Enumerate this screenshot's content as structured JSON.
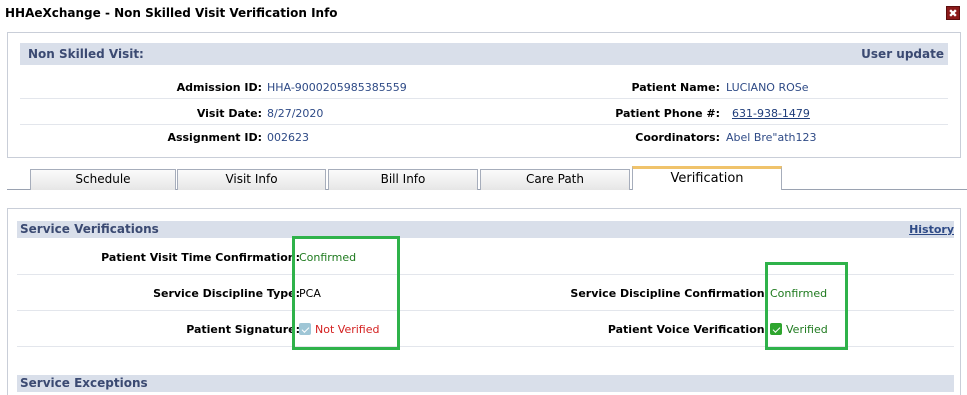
{
  "window": {
    "title": "HHAeXchange - Non Skilled Visit Verification Info",
    "close_glyph": "✖"
  },
  "visit": {
    "header_label": "Non Skilled Visit:",
    "header_right": "User update",
    "admission_id_label": "Admission ID:",
    "admission_id": "HHA-9000205985385559",
    "patient_name_label": "Patient Name:",
    "patient_name": "LUCIANO ROSe",
    "visit_date_label": "Visit Date:",
    "visit_date": "8/27/2020",
    "patient_phone_label": "Patient Phone #:",
    "patient_phone": "631-938-1479",
    "assignment_id_label": "Assignment ID:",
    "assignment_id": "002623",
    "coordinators_label": "Coordinators:",
    "coordinators": "Abel Bre\"ath123"
  },
  "tabs": [
    {
      "label": "Schedule"
    },
    {
      "label": "Visit Info"
    },
    {
      "label": "Bill Info"
    },
    {
      "label": "Care Path"
    },
    {
      "label": "Verification",
      "active": true
    }
  ],
  "service_verifications": {
    "header": "Service Verifications",
    "history_link": "History",
    "visit_time_label": "Patient Visit Time Confirmation:",
    "visit_time_value": "Confirmed",
    "discipline_type_label": "Service Discipline Type:",
    "discipline_type_value": "PCA",
    "discipline_confirmation_label": "Service Discipline Confirmation:",
    "discipline_confirmation_value": "Confirmed",
    "signature_label": "Patient Signature:",
    "signature_value": "Not Verified",
    "voice_label": "Patient Voice Verification:",
    "voice_value": "Verified"
  },
  "service_exceptions": {
    "header": "Service Exceptions"
  },
  "colors": {
    "header_bg": "#d9dfea",
    "header_text": "#3b4a72",
    "confirmed": "#1e7a1e",
    "not_verified": "#d42020",
    "highlight": "#2fb24a"
  }
}
